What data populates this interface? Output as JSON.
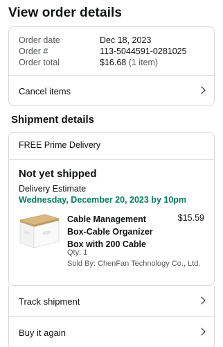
{
  "page": {
    "title": "View order details"
  },
  "order_summary": {
    "rows": [
      {
        "label": "Order date",
        "value": "Dec 18, 2023"
      },
      {
        "label": "Order #",
        "value": "113-5044591-0281025"
      },
      {
        "label": "Order total",
        "value": "$16.68",
        "note": "(1 item)"
      }
    ],
    "cancel_label": "Cancel items"
  },
  "shipment": {
    "section_title": "Shipment details",
    "delivery_type": "FREE Prime Delivery",
    "status": "Not yet shipped",
    "estimate_label": "Delivery Estimate",
    "estimate_date": "Wednesday, December 20, 2023 by 10pm",
    "item": {
      "title": "Cable Management Box-Cable Organizer Box with 200 Cable",
      "price": "$15.59",
      "qty": "Qty: 1",
      "seller": "Sold By: ChenFan Technology Co., Ltd.",
      "image_icon": "product-thumbnail"
    }
  },
  "actions": {
    "track_label": "Track shipment",
    "buy_again_label": "Buy it again"
  },
  "colors": {
    "accent_green": "#067d62",
    "border": "#d5d9d9",
    "muted_text": "#565959"
  }
}
